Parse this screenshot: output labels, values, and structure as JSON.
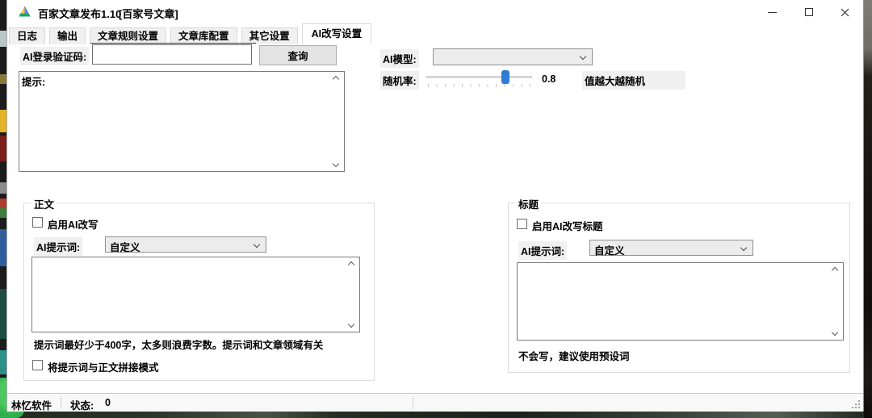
{
  "window": {
    "title": "百家文章发布1.10",
    "subtitle": "[百家号文章]"
  },
  "icons": {
    "app": "drive-triangle",
    "minimize": "minimize-line",
    "maximize": "maximize-box",
    "close": "close-x",
    "combo_chevron": "chevron-down",
    "scroll_up": "chevron-up",
    "scroll_down": "chevron-down",
    "resize_grip": "diagonal-grip"
  },
  "tabs": {
    "items": [
      {
        "label": "日志",
        "active": false
      },
      {
        "label": "输出",
        "active": false
      },
      {
        "label": "文章规则设置",
        "active": false
      },
      {
        "label": "文章库配置",
        "active": false
      },
      {
        "label": "其它设置",
        "active": false
      },
      {
        "label": "AI改写设置",
        "active": true
      }
    ]
  },
  "login_row": {
    "label": "AI登录验证码:",
    "input_value": "",
    "query_button": "查询"
  },
  "tips_box": {
    "text": "提示:"
  },
  "model_row": {
    "label": "AI模型:",
    "selected": ""
  },
  "random_row": {
    "label": "随机率:",
    "value": "0.8",
    "note": "值越大越随机",
    "slider_percent": 71
  },
  "body_group": {
    "legend": "正文",
    "enable_label": "启用AI改写",
    "enable_checked": false,
    "prompt_label": "AI提示词:",
    "prompt_selected": "自定义",
    "prompt_text": "",
    "hint": "提示词最好少于400字，太多则浪费字数。提示词和文章领域有关",
    "concat_label": "将提示词与正文拼接模式",
    "concat_checked": false
  },
  "title_group": {
    "legend": "标题",
    "enable_label": "启用AI改写标题",
    "enable_checked": false,
    "prompt_label": "AI提示词:",
    "prompt_selected": "自定义",
    "prompt_text": "",
    "hint": "不会写，建议使用预设词"
  },
  "statusbar": {
    "app_name": "林忆软件",
    "status_label": "状态:",
    "status_value": "0"
  },
  "colors": {
    "slider_thumb": "#2d7dd2",
    "label_bg": "#f0f0f0",
    "button_bg": "#e3e3e3",
    "tab_active_bg": "#ffffff",
    "tab_inactive_bg": "#f0f0f0",
    "border_dark": "#7a7a7a",
    "group_border": "#dcdcdc"
  }
}
